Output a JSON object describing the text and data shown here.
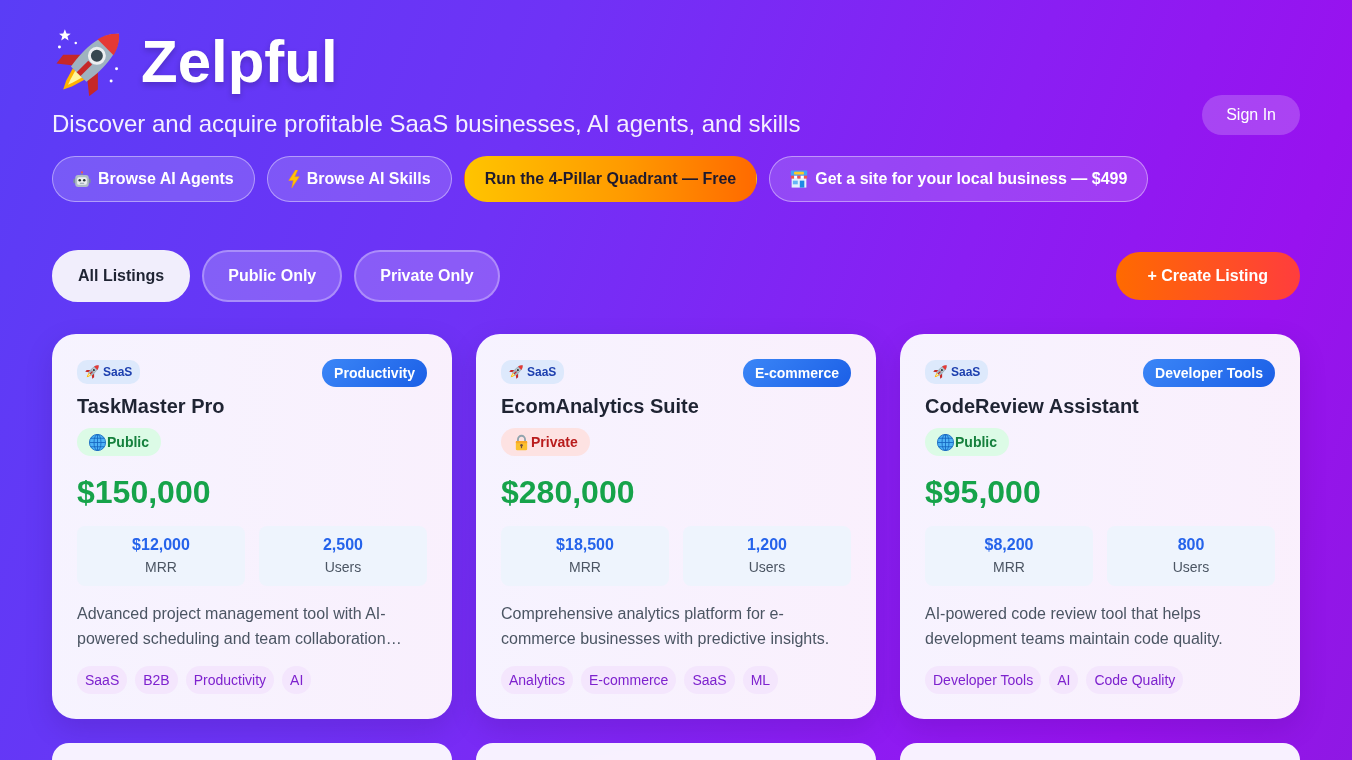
{
  "brand": {
    "name": "Zelpful",
    "tagline": "Discover and acquire profitable SaaS businesses, AI agents, and skills"
  },
  "sign_in": "Sign In",
  "nav_links": [
    {
      "label": "Browse AI Agents",
      "kind": "outline"
    },
    {
      "label": "Browse AI Skills",
      "kind": "outline"
    },
    {
      "label": "Run the 4-Pillar Quadrant — Free",
      "kind": "highlight"
    },
    {
      "label": "Get a site for your local business — $499",
      "kind": "outline"
    }
  ],
  "filters": [
    {
      "label": "All Listings",
      "selected": true
    },
    {
      "label": "Public Only",
      "selected": false
    },
    {
      "label": "Private Only",
      "selected": false
    }
  ],
  "create_button": "+ Create Listing",
  "listings": [
    {
      "type": "SaaS",
      "category": "Productivity",
      "name": "TaskMaster Pro",
      "visibility": {
        "kind": "public",
        "label": "Public"
      },
      "price": "$150,000",
      "stats": [
        {
          "value": "$12,000",
          "label": "MRR"
        },
        {
          "value": "2,500",
          "label": "Users"
        }
      ],
      "description": "Advanced project management tool with AI-powered scheduling and team collaboration…",
      "tags": [
        "SaaS",
        "B2B",
        "Productivity",
        "AI"
      ]
    },
    {
      "type": "SaaS",
      "category": "E-commerce",
      "name": "EcomAnalytics Suite",
      "visibility": {
        "kind": "private",
        "label": "Private"
      },
      "price": "$280,000",
      "stats": [
        {
          "value": "$18,500",
          "label": "MRR"
        },
        {
          "value": "1,200",
          "label": "Users"
        }
      ],
      "description": "Comprehensive analytics platform for e-commerce businesses with predictive insights.",
      "tags": [
        "Analytics",
        "E-commerce",
        "SaaS",
        "ML"
      ]
    },
    {
      "type": "SaaS",
      "category": "Developer Tools",
      "name": "CodeReview Assistant",
      "visibility": {
        "kind": "public",
        "label": "Public"
      },
      "price": "$95,000",
      "stats": [
        {
          "value": "$8,200",
          "label": "MRR"
        },
        {
          "value": "800",
          "label": "Users"
        }
      ],
      "description": "AI-powered code review tool that helps development teams maintain code quality.",
      "tags": [
        "Developer Tools",
        "AI",
        "Code Quality"
      ]
    }
  ]
}
